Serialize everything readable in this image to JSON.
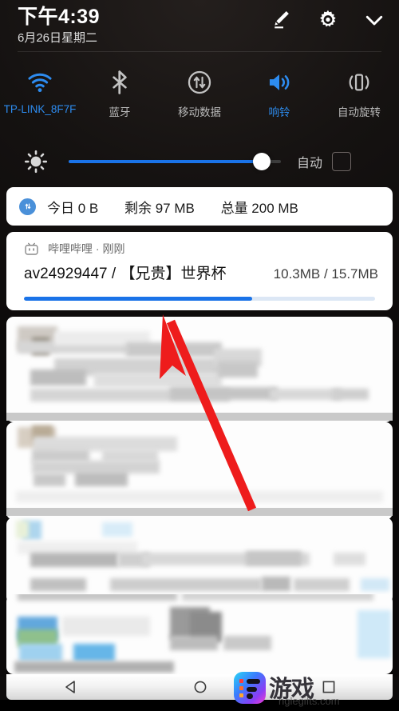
{
  "statusbar": {
    "time": "下午4:39",
    "date": "6月26日星期二",
    "icons": [
      {
        "name": "edit-icon",
        "label": "编辑"
      },
      {
        "name": "settings-gear-icon",
        "label": "设置"
      },
      {
        "name": "chevron-down-icon",
        "label": "收起"
      }
    ]
  },
  "quick_toggles": [
    {
      "id": "wifi",
      "icon": "wifi-icon",
      "label": "TP-LINK_8F7F",
      "active": true
    },
    {
      "id": "bluetooth",
      "icon": "bluetooth-icon",
      "label": "蓝牙",
      "active": false
    },
    {
      "id": "mobiledata",
      "icon": "mobile-data-icon",
      "label": "移动数据",
      "active": false
    },
    {
      "id": "ringer",
      "icon": "volume-icon",
      "label": "响铃",
      "active": true
    },
    {
      "id": "autorotate",
      "icon": "auto-rotate-icon",
      "label": "自动旋转",
      "active": false
    }
  ],
  "brightness": {
    "icon": "brightness-sun-icon",
    "value_percent": 91,
    "auto_label": "自动",
    "auto_checked": false
  },
  "data_card": {
    "icon": "data-usage-icon",
    "today_label": "今日 0 B",
    "remaining_label": "剩余 97 MB",
    "total_label": "总量 200 MB"
  },
  "notification": {
    "app_icon": "bilibili-tv-icon",
    "app_name": "哔哩哔哩",
    "separator": "·",
    "time": "刚刚",
    "title": "av24929447 / 【兄贵】世界杯",
    "size": "10.3MB / 15.7MB",
    "progress_percent": 65
  },
  "censored_notifications": [
    {
      "id": "blurred-card-1",
      "state": "blurred"
    },
    {
      "id": "blurred-card-2",
      "state": "blurred"
    },
    {
      "id": "blurred-card-3",
      "state": "blurred"
    },
    {
      "id": "blurred-card-4",
      "state": "blurred"
    }
  ],
  "annotation": {
    "type": "arrow",
    "color": "#ee1c1c",
    "points_to": "notification"
  },
  "navbar": [
    {
      "id": "back",
      "icon": "back-triangle-icon"
    },
    {
      "id": "home",
      "icon": "home-circle-icon"
    },
    {
      "id": "recents",
      "icon": "recents-square-icon"
    }
  ],
  "watermark": {
    "brand_cn": "游戏",
    "url": "nglegifts.com"
  },
  "colors": {
    "accent_blue": "#1a73e8",
    "toggle_active": "#2d8cf0",
    "annotation_red": "#ee1c1c",
    "card_bg": "#ffffff",
    "shade_bg": "#151211"
  }
}
